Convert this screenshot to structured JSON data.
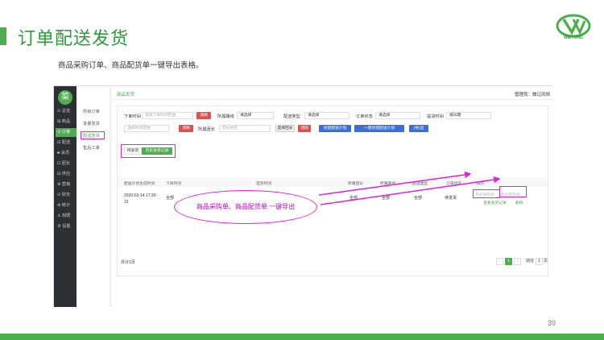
{
  "slide": {
    "title": "订单配送发货",
    "subtitle": "商品采购订单、商品配货单一键导出表格。",
    "page_number": "39",
    "logo_text": "WEITONG",
    "accent_color": "#4cae4c",
    "highlight_color": "#e020e0"
  },
  "app": {
    "logo_char": "菜",
    "nav": [
      {
        "label": "⊙ 总览"
      },
      {
        "label": "⊞ 商品"
      },
      {
        "label": "⊙ 订单"
      },
      {
        "label": "⊟ 配送"
      },
      {
        "label": "♣ 会员"
      },
      {
        "label": "⊡ 团长"
      },
      {
        "label": "⊟ 供应"
      },
      {
        "label": "⊕ 营销"
      },
      {
        "label": "⊙ 财务"
      },
      {
        "label": "⊕ 统计"
      },
      {
        "label": "♙ 权限"
      },
      {
        "label": "⚙ 设置"
      }
    ],
    "subnav": [
      {
        "label": "所有订单"
      },
      {
        "label": "批量发货"
      },
      {
        "label": "配送发货"
      },
      {
        "label": "售后工单"
      }
    ],
    "tab_header": "商品发货",
    "admin_label": "管理员：微记风倾",
    "filters": {
      "order_time_label": "下单时间",
      "order_time_placeholder": "选择下单时间范围",
      "clear_label": "清除",
      "route_label": "所属路线",
      "route_value": "请选择",
      "delivery_type_label": "配送类型",
      "delivery_type_value": "请选择",
      "order_status_label": "订单状态",
      "order_status_value": "请选择",
      "pickup_time_label": "提货时间",
      "pickup_time_value": "按日期",
      "group_time_placeholder": "选择时间范围",
      "clear2_label": "清除",
      "leader_label": "所属团长",
      "leader_placeholder": "团长姓名",
      "choose_leader_label": "选择团长",
      "clear3_label": "清除",
      "create_plan_label": "创建配送计划",
      "one_click_plan_label": "一键创建配送计划",
      "export_label": "(导)出"
    },
    "tabs": {
      "pending": "待发货",
      "history": "历史发货记录"
    },
    "table": {
      "headers": [
        "配送计划生成时间",
        "下单时间",
        "提货时间",
        "所属团长",
        "所属路线",
        "配送类型",
        "订单状态",
        "操作"
      ],
      "row": {
        "plan_time": "2020-02-14 17:30:",
        "plan_time2": "16",
        "order_time": "全部",
        "pickup_time": "全部",
        "leader": "全部",
        "route": "全部",
        "delivery_type": "全部",
        "status": "待发货",
        "op1": "商品采购单",
        "op2": "商品配货单",
        "op3": "查看发货记录",
        "op4": "删除"
      }
    },
    "pagination": {
      "total": "共计1页",
      "prev": "‹",
      "current": "1",
      "next": "›",
      "goto_label": "前往",
      "goto_value": "1",
      "page_suffix": "页"
    }
  },
  "callout": {
    "text": "商品采购单、商品配货单 一键导出"
  }
}
